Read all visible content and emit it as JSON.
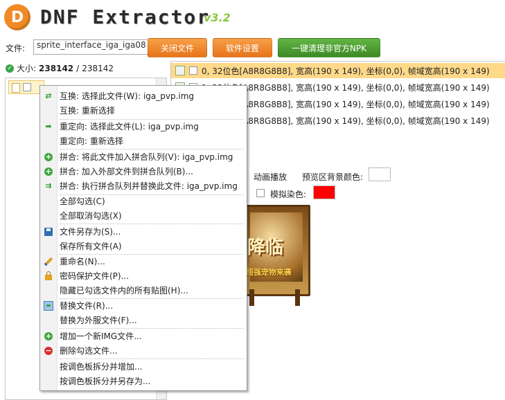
{
  "app": {
    "logo_letter": "D",
    "title": "DNF Extractor",
    "version": "v3.2"
  },
  "toolbar": {
    "file_label": "文件:",
    "file_value": "sprite_interface_iga_iga08",
    "btn_close_file": "关闭文件",
    "btn_settings": "软件设置",
    "btn_clean": "一键清理非官方NPK"
  },
  "status": {
    "size_label": "大小:",
    "size_value": "238142",
    "size_sep": "/",
    "size_total": "238142"
  },
  "frames": [
    "0, 32位色[A8R8G8B8], 宽高(190 x 149), 坐标(0,0), 帧域宽高(190 x 149)",
    "1, 32位色[A8R8G8B8], 宽高(190 x 149), 坐标(0,0), 帧域宽高(190 x 149)",
    "2, 32位色[A8R8G8B8], 宽高(190 x 149), 坐标(0,0), 帧域宽高(190 x 149)",
    "3, 32位色[A8R8G8B8], 宽高(190 x 149), 坐标(0,0), 帧域宽高(190 x 149)"
  ],
  "controls": {
    "animate": "动画播放",
    "bg_color_label": "预览区背景颜色:",
    "bg_color": "#ffffff",
    "dye_label": "模拟染色:",
    "dye_color": "#ff0000"
  },
  "preview": {
    "big_text": "降临",
    "small_text": "超强宠物来袭"
  },
  "context_menu": {
    "items": [
      "互换: 选择此文件(W): iga_pvp.img",
      "互换: 重新选择",
      "重定向: 选择此文件(L): iga_pvp.img",
      "重定向: 重新选择",
      "拼合: 将此文件加入拼合队列(V): iga_pvp.img",
      "拼合: 加入外部文件到拼合队列(B)...",
      "拼合: 执行拼合队列并替换此文件: iga_pvp.img",
      "全部勾选(C)",
      "全部取消勾选(X)",
      "文件另存为(S)...",
      "保存所有文件(A)",
      "重命名(N)...",
      "密码保护文件(P)...",
      "隐藏已勾选文件内的所有贴图(H)...",
      "替换文件(R)...",
      "替换为外服文件(F)...",
      "增加一个新IMG文件...",
      "删除勾选文件...",
      "按调色板拆分并增加...",
      "按调色板拆分并另存为..."
    ]
  },
  "colors": {
    "accent_orange": "#e8741b",
    "accent_green": "#3d8a26",
    "selection": "#ffd98a"
  }
}
